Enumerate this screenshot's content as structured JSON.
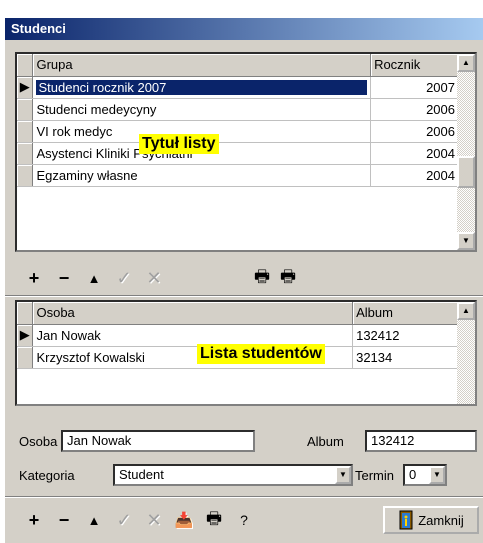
{
  "window": {
    "title": "Studenci"
  },
  "groups_grid": {
    "columns": [
      "Grupa",
      "Rocznik"
    ],
    "rows": [
      {
        "grupa": "Studenci rocznik 2007",
        "rocznik": "2007",
        "selected": true
      },
      {
        "grupa": "Studenci medeycyny",
        "rocznik": "2006"
      },
      {
        "grupa": "VI rok medyc",
        "rocznik": "2006"
      },
      {
        "grupa": "Asystenci Kliniki Psychiatrii",
        "rocznik": "2004"
      },
      {
        "grupa": "Egzaminy własne",
        "rocznik": "2004"
      }
    ]
  },
  "annotations": {
    "list_title": "Tytuł listy",
    "student_list": "Lista studentów"
  },
  "toolbar1": {
    "add": "+",
    "delete": "−",
    "up": "▲",
    "confirm": "✓",
    "cancel": "✕",
    "print1": "🖶",
    "print2": "🖶"
  },
  "students_grid": {
    "columns": [
      "Osoba",
      "Album"
    ],
    "rows": [
      {
        "osoba": "Jan Nowak",
        "album": "132412",
        "selected": true
      },
      {
        "osoba": "Krzysztof Kowalski",
        "album": "32134"
      }
    ]
  },
  "form": {
    "osoba_label": "Osoba",
    "osoba_value": "Jan Nowak",
    "album_label": "Album",
    "album_value": "132412",
    "kategoria_label": "Kategoria",
    "kategoria_value": "Student",
    "termin_label": "Termin",
    "termin_value": "0"
  },
  "toolbar2": {
    "add": "+",
    "delete": "−",
    "up": "▲",
    "confirm": "✓",
    "cancel": "✕",
    "import": "📥",
    "print": "🖶",
    "help": "?",
    "close_label": "Zamknij"
  }
}
